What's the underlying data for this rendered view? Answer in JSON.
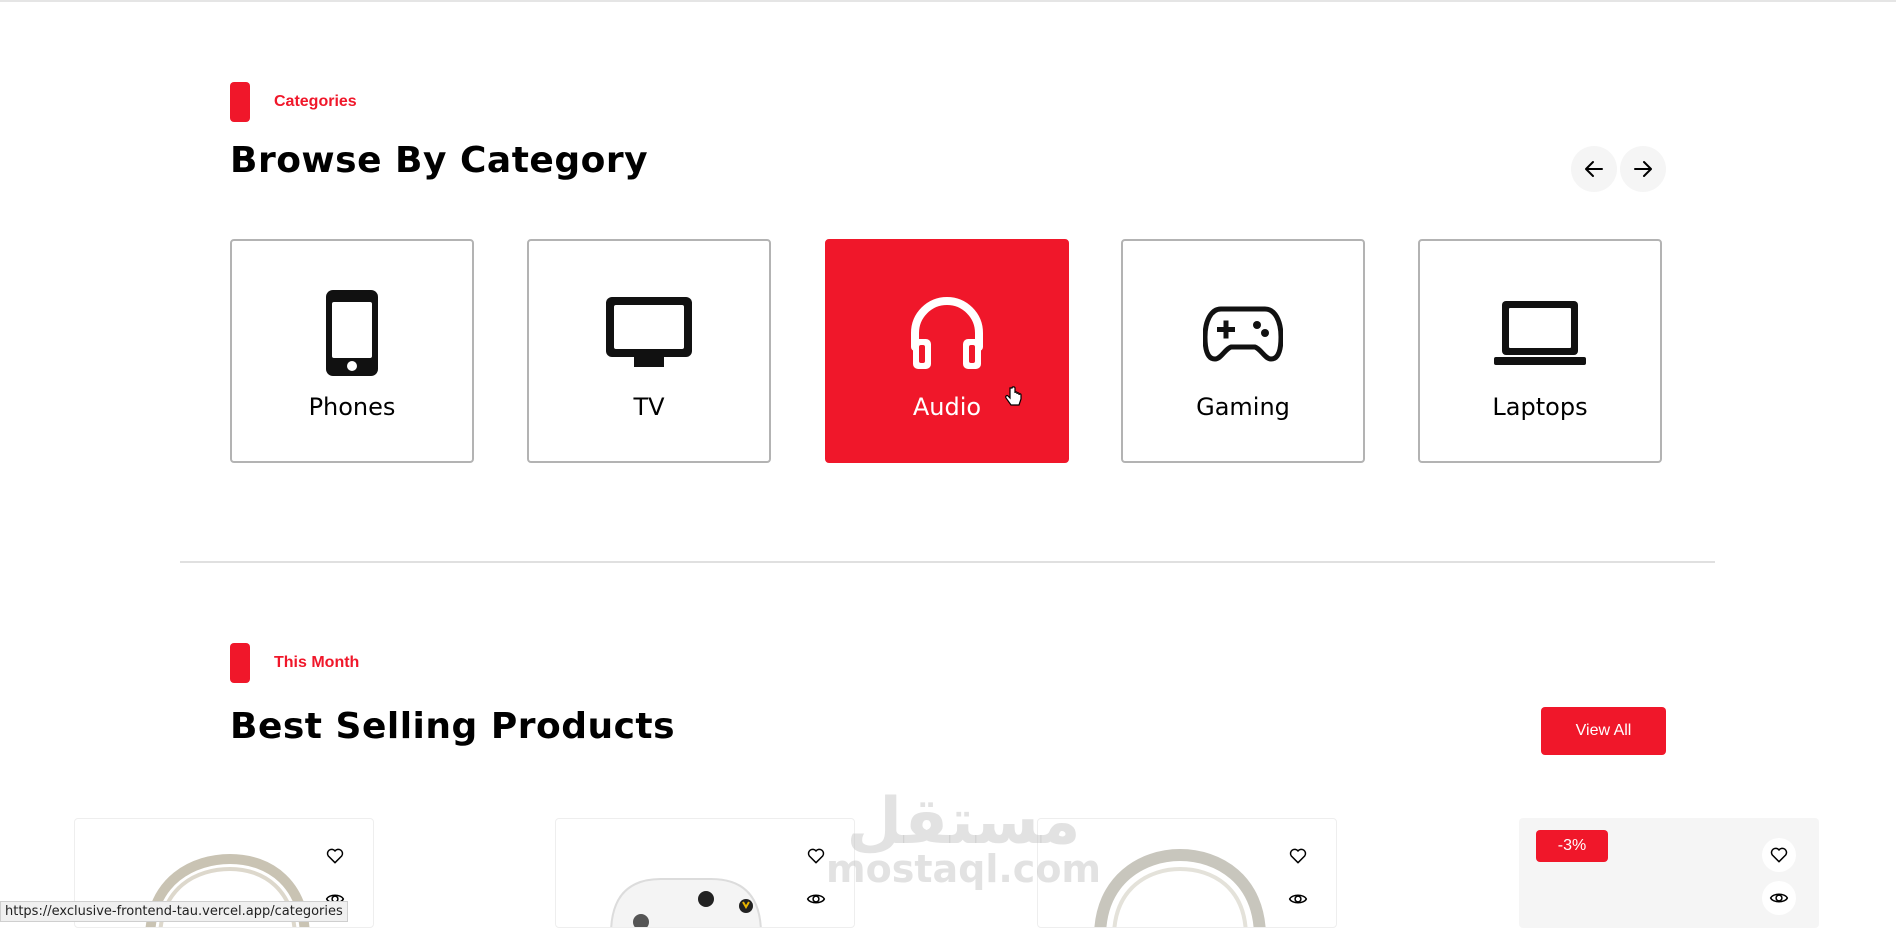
{
  "categories_section": {
    "tag": "Categories",
    "title": "Browse By Category",
    "items": [
      {
        "label": "Phones",
        "icon": "phone-icon",
        "active": false
      },
      {
        "label": "TV",
        "icon": "tv-icon",
        "active": false
      },
      {
        "label": "Audio",
        "icon": "headphones-icon",
        "active": true
      },
      {
        "label": "Gaming",
        "icon": "gamepad-icon",
        "active": false
      },
      {
        "label": "Laptops",
        "icon": "laptop-icon",
        "active": false
      }
    ]
  },
  "best_selling": {
    "tag": "This Month",
    "title": "Best Selling Products",
    "view_all_label": "View All",
    "products": [
      {
        "image": "headphones-image",
        "discount": null
      },
      {
        "image": "controller-image",
        "discount": null
      },
      {
        "image": "headphones-image",
        "discount": null
      },
      {
        "image": "product-image",
        "discount": "-3%"
      }
    ]
  },
  "watermark": {
    "arabic": "مستقل",
    "latin": "mostaql.com"
  },
  "status_bar": {
    "url": "https://exclusive-frontend-tau.vercel.app/categories"
  },
  "colors": {
    "accent": "#f0172a",
    "card_border": "#b3b3b3",
    "button_bg": "#f5f5f5"
  }
}
